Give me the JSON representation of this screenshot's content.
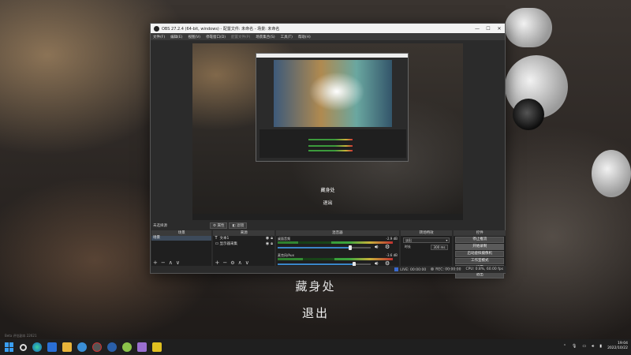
{
  "desktop": {
    "overlay_title": "藏身处",
    "overlay_exit": "退出",
    "watermark": "Beta 评估副本 22621"
  },
  "obs": {
    "window_title": "OBS 27.2.4 (64-bit, windows) - 配置文件: 未命名 - 场景: 未命名",
    "window_controls": [
      "—",
      "☐",
      "✕"
    ],
    "menu": [
      "文件(F)",
      "编辑(E)",
      "视图(V)",
      "停靠窗口(D)",
      "配置文件(P)",
      "场景集合(S)",
      "工具(T)",
      "帮助(H)"
    ],
    "preview_text_1": "藏身处",
    "preview_text_2": "退出",
    "source_none": "未选择源",
    "properties_btn": "属性",
    "filters_btn": "滤镜",
    "docks": {
      "scenes": {
        "title": "场景",
        "items": [
          "场景"
        ],
        "selected": "场景"
      },
      "sources": {
        "title": "来源",
        "items": [
          {
            "icon": "text-icon",
            "glyph": "T",
            "label": "文本1"
          },
          {
            "icon": "monitor-icon",
            "glyph": "▭",
            "label": "显示器采集"
          }
        ]
      },
      "mixer": {
        "title": "混音器",
        "channels": [
          {
            "name": "桌面音频",
            "level_db": "-2.9 dB",
            "meter_level": 0.18,
            "volume": 0.78
          },
          {
            "name": "麦克风/Aux",
            "level_db": "-3.6 dB",
            "meter_level": 0.22,
            "volume": 0.82
          }
        ]
      },
      "transitions": {
        "title": "转场特效",
        "type": "淡出",
        "duration_label": "时长",
        "duration_value": "300 ms"
      },
      "controls": {
        "title": "控件",
        "buttons": [
          "停止推流",
          "开始录制",
          "启动虚拟摄像机",
          "工作室模式",
          "设置",
          "退出"
        ],
        "active": "开始录制"
      }
    },
    "footer_buttons": [
      "+",
      "−",
      "⚙",
      "∧",
      "∨"
    ],
    "statusbar": {
      "live": "LIVE: 00:00:00",
      "rec": "REC: 00:00:00",
      "cpu": "CPU: 0.8%, 60.00 fps"
    }
  },
  "taskbar": {
    "clock_time": "19:04",
    "clock_date": "2022/10/22",
    "tray_icons": [
      "chevron-up-icon",
      "mic-icon",
      "network-icon",
      "volume-icon",
      "battery-icon"
    ]
  },
  "colors": {
    "accent": "#3a86c8",
    "meter_green": "#3da63d",
    "meter_yellow": "#c8b23a",
    "meter_red": "#c03030"
  }
}
